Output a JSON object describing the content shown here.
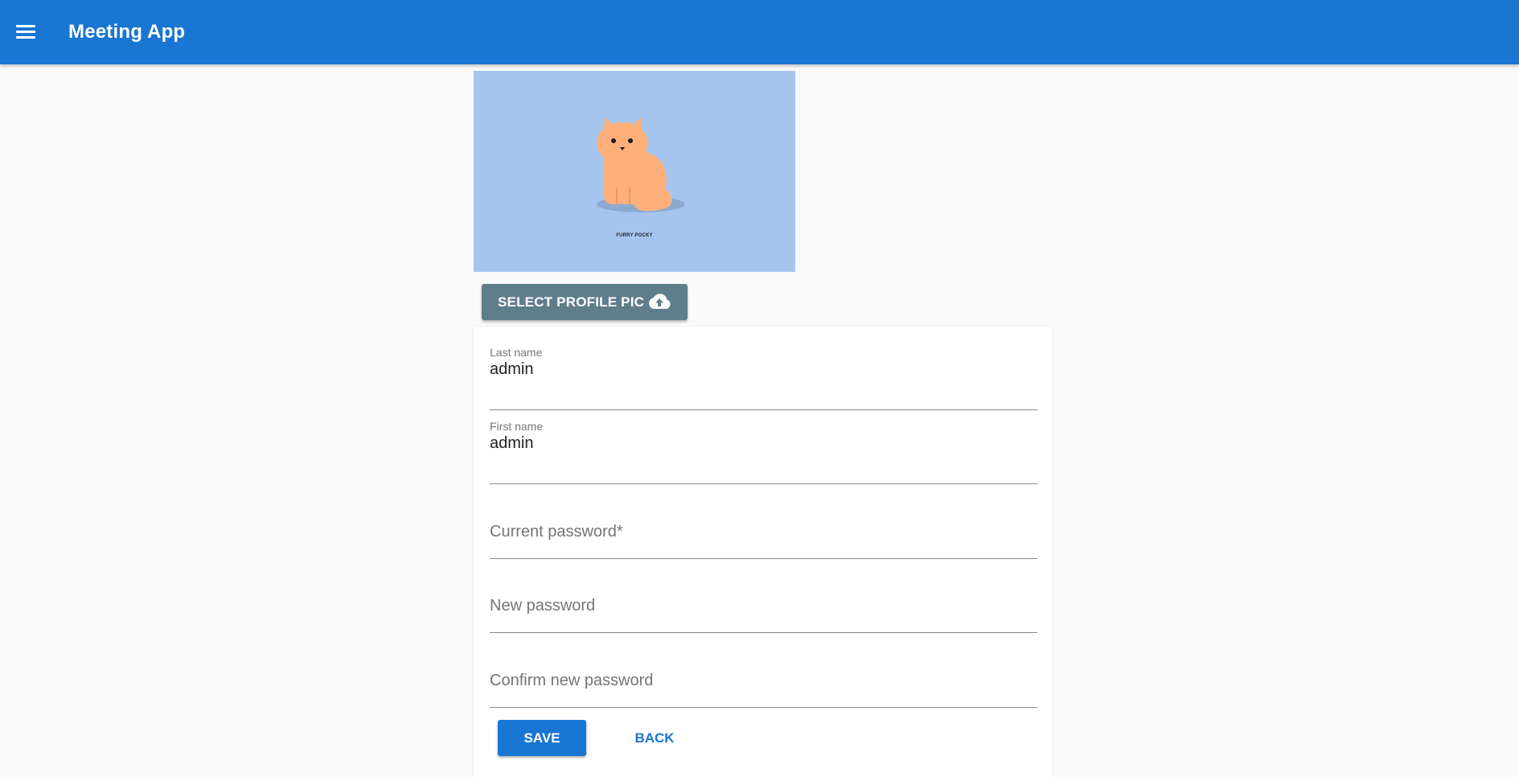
{
  "app": {
    "title": "Meeting App",
    "primary_color": "#1976d2",
    "menu_icon": "menu-icon"
  },
  "profile": {
    "picture_caption": "FURRY POCKY",
    "picture_background": "#a5c5ee",
    "select_button_label": "SELECT PROFILE PIC",
    "select_button_icon": "cloud-upload-icon"
  },
  "form": {
    "last_name": {
      "label": "Last name",
      "value": "admin"
    },
    "first_name": {
      "label": "First name",
      "value": "admin"
    },
    "current_password": {
      "placeholder": "Current password*",
      "value": ""
    },
    "new_password": {
      "placeholder": "New password",
      "value": ""
    },
    "confirm_password": {
      "placeholder": "Confirm new password",
      "value": ""
    }
  },
  "actions": {
    "save_label": "SAVE",
    "back_label": "BACK"
  }
}
